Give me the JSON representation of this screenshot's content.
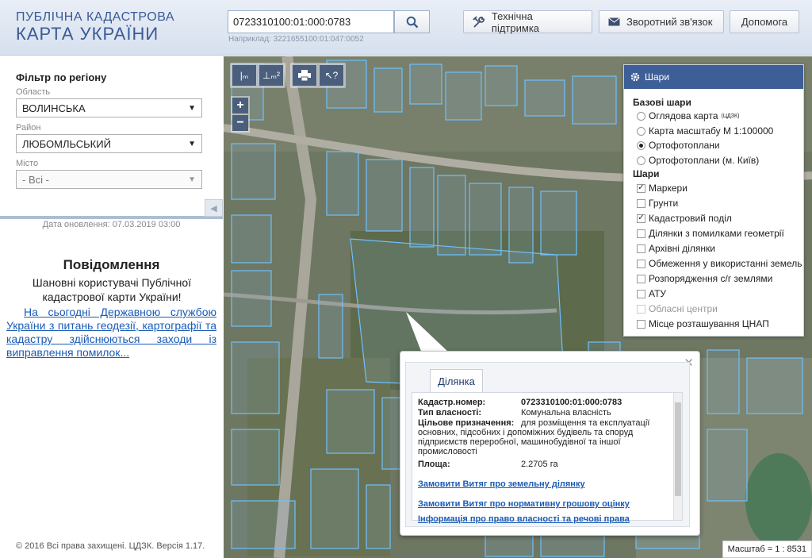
{
  "logo": {
    "line1": "ПУБЛІЧНА КАДАСТРОВА",
    "line2": "КАРТА УКРАЇНИ"
  },
  "search": {
    "value": "0723310100:01:000:0783",
    "hint": "Наприклад: 3221655100:01:047:0052",
    "icon": "search-icon"
  },
  "header_buttons": {
    "support": {
      "label": "Технічна підтримка",
      "icon": "tools-icon"
    },
    "feedback": {
      "label": "Зворотний зв'язок",
      "icon": "envelope-icon"
    },
    "help": {
      "label": "Допомога"
    }
  },
  "filter": {
    "title": "Фільтр по регіону",
    "oblast_label": "Область",
    "oblast_value": "ВОЛИНСЬКА",
    "raion_label": "Район",
    "raion_value": "ЛЮБОМЛЬСЬКИЙ",
    "misto_label": "Місто",
    "misto_value": "- Всі -"
  },
  "update_date": "Дата оновлення: 07.03.2019 03:00",
  "message": {
    "title": "Повідомлення",
    "text": "Шановні користувачі Публічної кадастрової карти України!",
    "link": "На сьогодні Державною службою України з питань геодезії, картографії та кадастру здійснюються заходи із виправлення помилок..."
  },
  "copyright": "© 2016 Всі права захищені. ЦДЗК. Версія 1.17.",
  "layers": {
    "title": "Шари",
    "base_title": "Базові шари",
    "base": [
      {
        "label": "Оглядова карта",
        "sup": "(ЦДЗК)",
        "selected": false
      },
      {
        "label": "Карта масштабу М 1:100000",
        "selected": false
      },
      {
        "label": "Ортофотоплани",
        "selected": true
      },
      {
        "label": "Ортофотоплани (м. Київ)",
        "selected": false
      }
    ],
    "overlay_title": "Шари",
    "overlays": [
      {
        "label": "Маркери",
        "checked": true
      },
      {
        "label": "Грунти",
        "checked": false
      },
      {
        "label": "Кадастровий поділ",
        "checked": true
      },
      {
        "label": "Ділянки з помилками геометрії",
        "checked": false
      },
      {
        "label": "Архівні ділянки",
        "checked": false
      },
      {
        "label": "Обмеження у використанні земель",
        "checked": false
      },
      {
        "label": "Розпорядження с/г землями",
        "checked": false
      },
      {
        "label": "АТУ",
        "checked": false
      },
      {
        "label": "Обласні центри",
        "checked": false,
        "disabled": true
      },
      {
        "label": "Місце розташування ЦНАП",
        "checked": false
      }
    ]
  },
  "popup": {
    "tab": "Ділянка",
    "rows": [
      {
        "key": "Кадастр.номер:",
        "value": "0723310100:01:000:0783",
        "bold": true
      },
      {
        "key": "Тип власності:",
        "value": "Комунальна власність"
      },
      {
        "key": "Цільове призначення:",
        "value": "для розміщення та експлуатації основних, підсобних і допоміжних будівель та споруд підприємств переробної, машинобудівної та іншої промисловості"
      },
      {
        "key": "Площа:",
        "value": "2.2705 га"
      }
    ],
    "links": [
      "Замовити Витяг про земельну ділянку",
      "Замовити Витяг про нормативну грошову оцінку",
      "Інформація про право власності та речові права"
    ]
  },
  "scale": "Масштаб = 1 : 8531"
}
